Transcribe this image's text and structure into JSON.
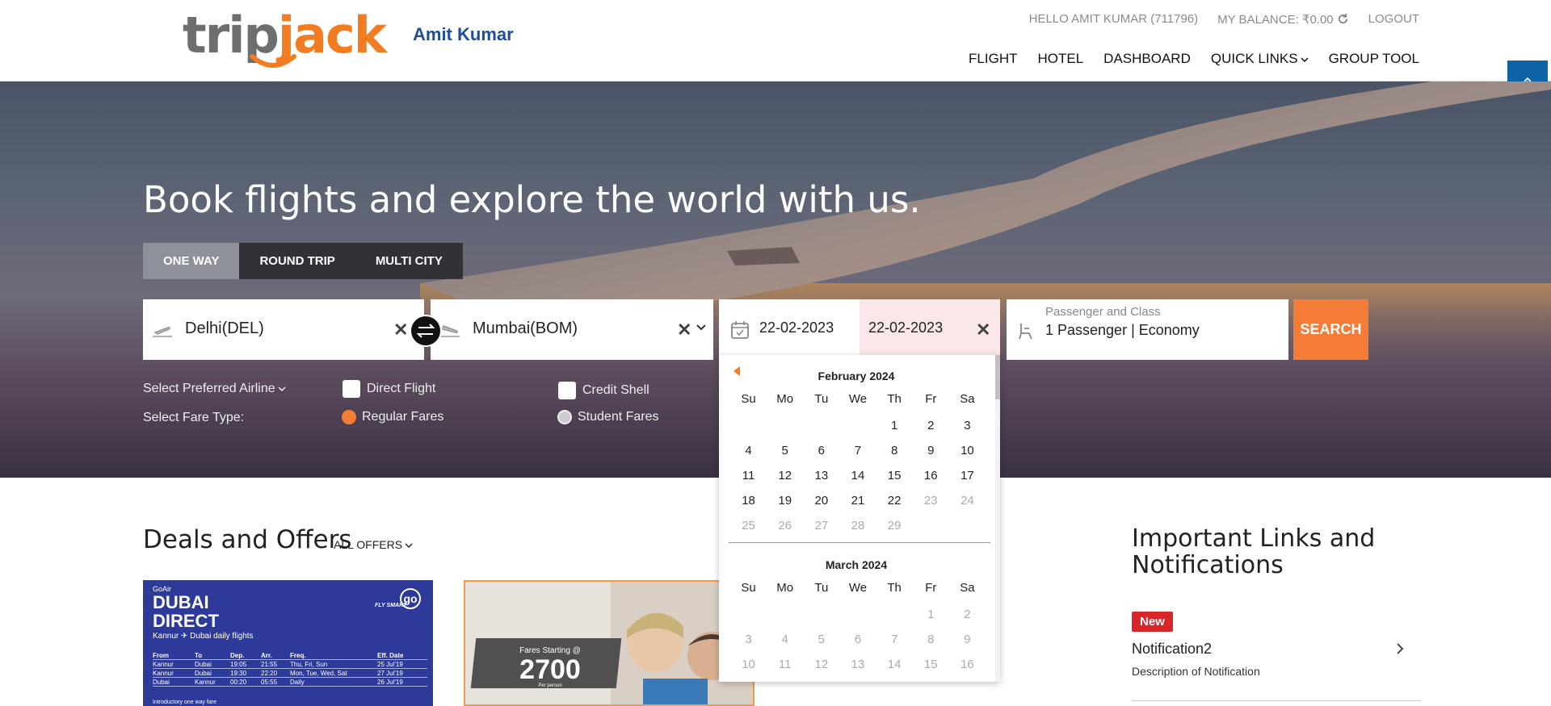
{
  "brand": {
    "logo_part1": "trip",
    "logo_part2": "jack",
    "user_display": "Amit Kumar",
    "accent": "#f47c20",
    "nav_blue": "#1f4e96"
  },
  "top_links": {
    "greeting": "HELLO AMIT KUMAR (711796)",
    "balance": "MY BALANCE: ₹0.00",
    "logout": "LOGOUT"
  },
  "nav": {
    "flight": "FLIGHT",
    "hotel": "HOTEL",
    "dashboard": "DASHBOARD",
    "quick_links": "QUICK LINKS",
    "group_tool": "GROUP TOOL"
  },
  "scroll_top_icon": "double-chevron-up-icon",
  "hero": {
    "title": "Book flights and explore the world with us."
  },
  "trip_tabs": {
    "one_way": "ONE WAY",
    "round_trip": "ROUND TRIP",
    "multi_city": "MULTI CITY",
    "active": "ONE WAY"
  },
  "search": {
    "from": "Delhi(DEL)",
    "to": "Mumbai(BOM)",
    "depart_date": "22-02-2023",
    "return_date": "22-02-2023",
    "pax_label": "Passenger and Class",
    "pax_value": "1 Passenger | Economy",
    "search_label": "SEARCH",
    "clear_glyph": "✕"
  },
  "options": {
    "preferred_airline": "Select Preferred Airline",
    "direct_flight": "Direct Flight",
    "credit_shell": "Credit Shell",
    "fare_type_label": "Select Fare Type:",
    "regular_fares": "Regular Fares",
    "student_fares": "Student Fares"
  },
  "calendar": {
    "weekdays": [
      "Su",
      "Mo",
      "Tu",
      "We",
      "Th",
      "Fr",
      "Sa"
    ],
    "months": [
      {
        "name": "February 2024",
        "cells": [
          [
            "",
            "",
            "",
            "",
            "1",
            "2",
            "3"
          ],
          [
            "4",
            "5",
            "6",
            "7",
            "8",
            "9",
            "10"
          ],
          [
            "11",
            "12",
            "13",
            "14",
            "15",
            "16",
            "17"
          ],
          [
            "18",
            "19",
            "20",
            "21",
            "22",
            "23",
            "24"
          ],
          [
            "25",
            "26",
            "27",
            "28",
            "29",
            "",
            ""
          ]
        ],
        "last_enabled_day": 22
      },
      {
        "name": "March 2024",
        "cells": [
          [
            "",
            "",
            "",
            "",
            "",
            "1",
            "2"
          ],
          [
            "3",
            "4",
            "5",
            "6",
            "7",
            "8",
            "9"
          ],
          [
            "10",
            "11",
            "12",
            "13",
            "14",
            "15",
            "16"
          ]
        ],
        "last_enabled_day": 0
      }
    ]
  },
  "deals": {
    "title": "Deals and Offers",
    "all_offers": "ALL OFFERS",
    "card1": {
      "brand": "GoAir",
      "headline1": "DUBAI",
      "headline2": "DIRECT",
      "sub": "Kannur ✈ Dubai daily flights",
      "tagline": "FLY SMART",
      "table_headers": [
        "From",
        "To",
        "Dep.",
        "Arr.",
        "Freq.",
        "Eff. Date"
      ],
      "rows": [
        [
          "Kannur",
          "Dubai",
          "19:05",
          "21:55",
          "Thu, Fri, Sun",
          "25 Jul'19"
        ],
        [
          "Kannur",
          "Dubai",
          "19:30",
          "22:20",
          "Mon, Tue, Wed, Sat",
          "27 Jul'19"
        ],
        [
          "Dubai",
          "Kannur",
          "00:20",
          "05:55",
          "Daily",
          "26 Jul'19"
        ]
      ],
      "footer": "Introductory one way fare"
    },
    "card2": {
      "fares_label": "Fares Starting @",
      "price": "2700",
      "per_person": "Per person"
    }
  },
  "links_panel": {
    "title": "Important Links and Notifications",
    "badge": "New",
    "notification_title": "Notification2",
    "notification_desc": "Description of Notification"
  }
}
